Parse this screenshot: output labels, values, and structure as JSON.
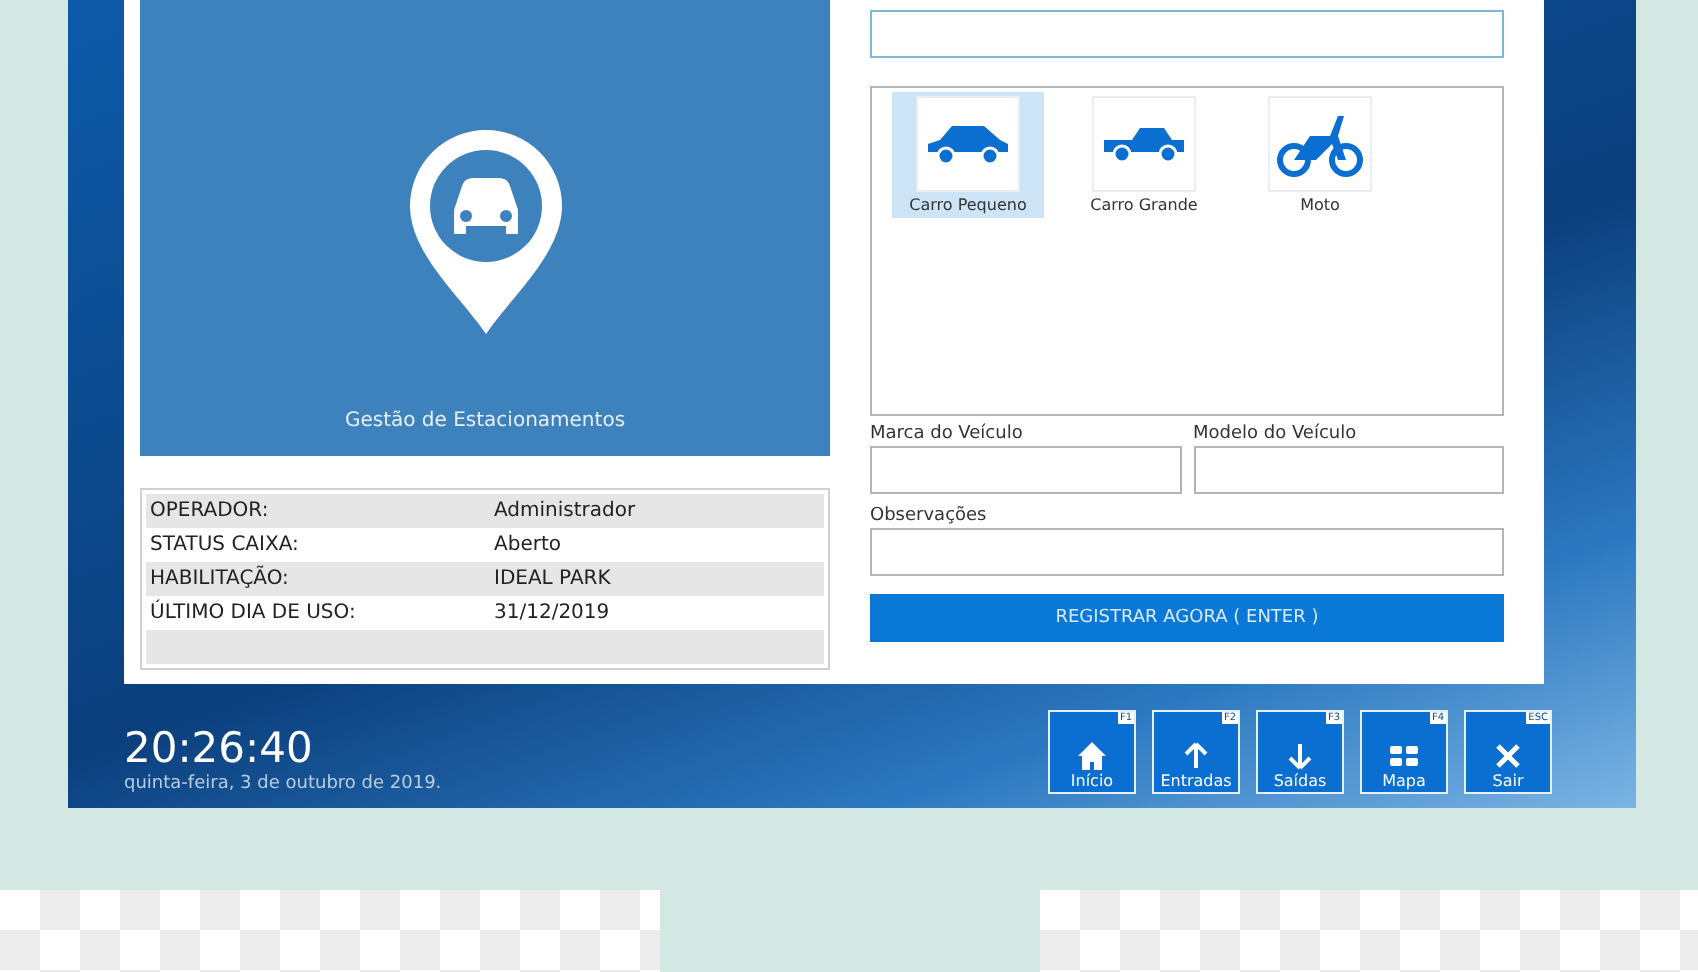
{
  "brand_panel": {
    "title": "Gestão de Estacionamentos"
  },
  "info_table": {
    "rows": [
      {
        "label": "OPERADOR:",
        "value": "Administrador"
      },
      {
        "label": "STATUS CAIXA:",
        "value": "Aberto"
      },
      {
        "label": "HABILITAÇÃO:",
        "value": "IDEAL PARK"
      },
      {
        "label": "ÚLTIMO DIA DE USO:",
        "value": "31/12/2019"
      }
    ]
  },
  "vehicle_types": [
    {
      "kind": "small-car",
      "label": "Carro Pequeno",
      "selected": true
    },
    {
      "kind": "pickup",
      "label": "Carro Grande",
      "selected": false
    },
    {
      "kind": "motorcycle",
      "label": "Moto",
      "selected": false
    }
  ],
  "fields": [
    {
      "label": "Marca do Veículo"
    },
    {
      "label": "Modelo do Veículo"
    },
    {
      "label": "Observações"
    }
  ],
  "submit_button": "REGISTRAR AGORA ( ENTER )",
  "clock": {
    "time": "20:26:40",
    "date": "quinta-feira, 3 de outubro de 2019."
  },
  "nav_buttons": [
    {
      "kind": "home",
      "key": "F1",
      "label": "Início"
    },
    {
      "kind": "up",
      "key": "F2",
      "label": "Entradas"
    },
    {
      "kind": "down",
      "key": "F3",
      "label": "Saídas"
    },
    {
      "kind": "map",
      "key": "F4",
      "label": "Mapa"
    },
    {
      "kind": "close",
      "key": "ESC",
      "label": "Sair"
    }
  ]
}
